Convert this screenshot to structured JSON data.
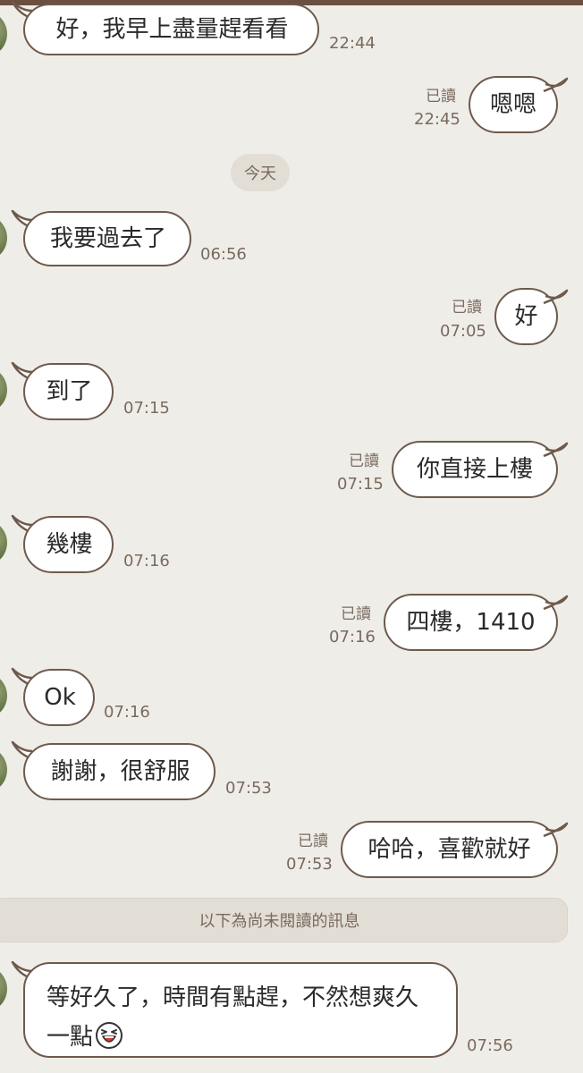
{
  "colors": {
    "background": "#efede8",
    "bubble_border": "#6e5a4c",
    "bubble_fill": "#ffffff",
    "meta_text": "#7a6a5e"
  },
  "date_separator": "今天",
  "unread_divider": "以下為尚未閱讀的訊息",
  "messages": [
    {
      "dir": "in",
      "text": "好，我早上盡量趕看看",
      "time": "22:44"
    },
    {
      "dir": "out",
      "text": "嗯嗯",
      "time": "22:45",
      "status": "已讀"
    },
    {
      "dir": "in",
      "text": "我要過去了",
      "time": "06:56"
    },
    {
      "dir": "out",
      "text": "好",
      "time": "07:05",
      "status": "已讀"
    },
    {
      "dir": "in",
      "text": "到了",
      "time": "07:15"
    },
    {
      "dir": "out",
      "text": "你直接上樓",
      "time": "07:15",
      "status": "已讀"
    },
    {
      "dir": "in",
      "text": "幾樓",
      "time": "07:16"
    },
    {
      "dir": "out",
      "text": "四樓，1410",
      "time": "07:16",
      "status": "已讀"
    },
    {
      "dir": "in",
      "text": "Ok",
      "time": "07:16"
    },
    {
      "dir": "in",
      "text": "謝謝，很舒服",
      "time": "07:53"
    },
    {
      "dir": "out",
      "text": "哈哈，喜歡就好",
      "time": "07:53",
      "status": "已讀"
    },
    {
      "dir": "in",
      "text": "等好久了，時間有點趕，不然想爽久一點",
      "time": "07:56",
      "sticker": "laughing-face-sticker"
    }
  ]
}
